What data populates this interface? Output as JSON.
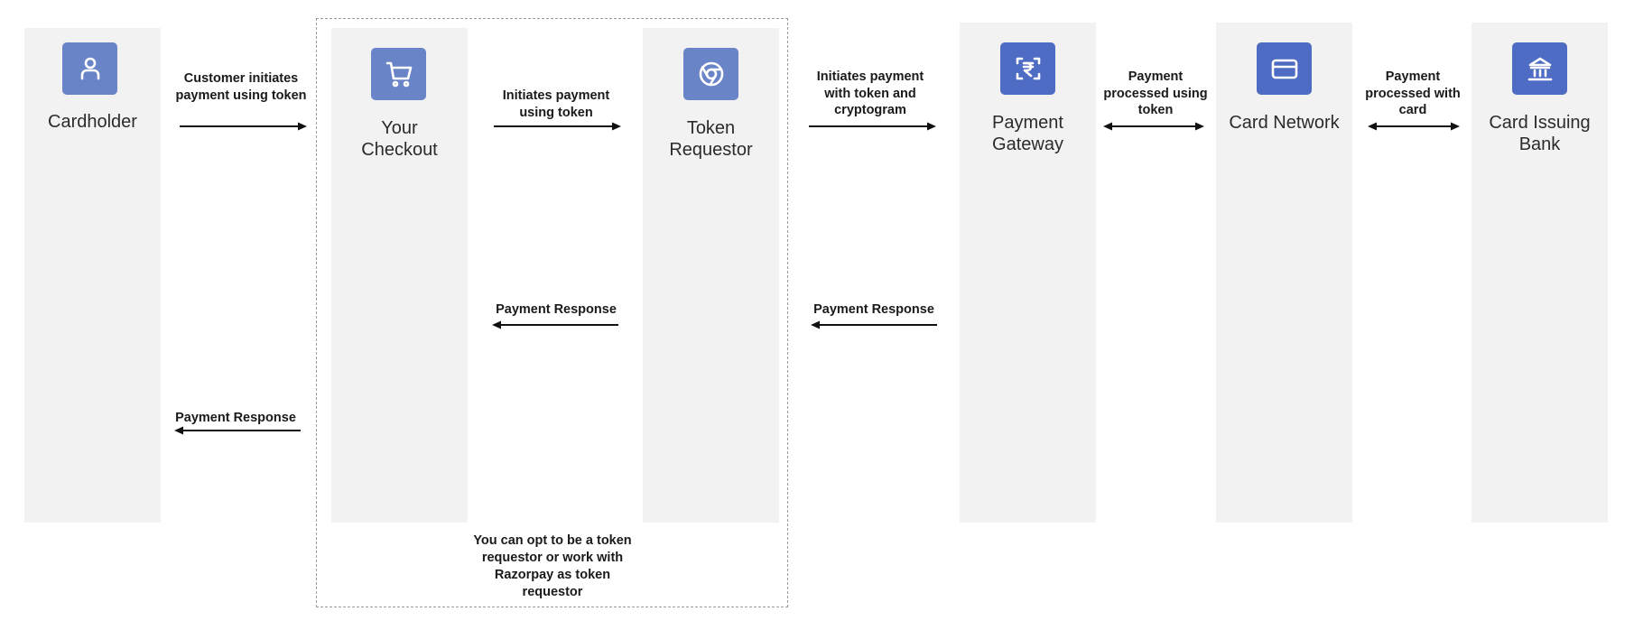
{
  "diagram": {
    "colors": {
      "column_bg": "#f2f2f2",
      "icon_bg_light": "#6a84c8",
      "icon_bg_dark": "#4e6cc4",
      "arrow": "#111111",
      "dashed_border": "#9a9a9a"
    },
    "nodes": [
      {
        "id": "cardholder",
        "title": "Cardholder",
        "icon": "user-icon"
      },
      {
        "id": "your-checkout",
        "title_line1": "Your",
        "title_line2": "Checkout",
        "icon": "shopping-cart-icon"
      },
      {
        "id": "token-requestor",
        "title_line1": "Token",
        "title_line2": "Requestor",
        "icon": "chrome-browser-icon"
      },
      {
        "id": "payment-gateway",
        "title_line1": "Payment",
        "title_line2": "Gateway",
        "icon": "rupee-scan-icon"
      },
      {
        "id": "card-network",
        "title": "Card Network",
        "icon": "credit-card-icon"
      },
      {
        "id": "card-issuing-bank",
        "title_line1": "Card Issuing",
        "title_line2": "Bank",
        "icon": "bank-icon"
      }
    ],
    "edges": [
      {
        "from": "cardholder",
        "to": "your-checkout",
        "direction": "right",
        "label_lines": [
          "Customer initiates",
          "payment using token"
        ]
      },
      {
        "from": "your-checkout",
        "to": "token-requestor",
        "direction": "right",
        "label_lines": [
          "Initiates payment",
          "using token"
        ]
      },
      {
        "from": "token-requestor",
        "to": "payment-gateway",
        "direction": "right",
        "label_lines": [
          "Initiates payment",
          "with token and",
          "cryptogram"
        ]
      },
      {
        "from": "payment-gateway",
        "to": "card-network",
        "direction": "both",
        "label_lines": [
          "Payment",
          "processed using",
          "token"
        ]
      },
      {
        "from": "card-network",
        "to": "card-issuing-bank",
        "direction": "both",
        "label_lines": [
          "Payment",
          "processed with",
          "card"
        ]
      },
      {
        "from": "token-requestor",
        "to": "your-checkout",
        "direction": "left",
        "label_lines": [
          "Payment Response"
        ]
      },
      {
        "from": "payment-gateway",
        "to": "token-requestor",
        "direction": "left",
        "label_lines": [
          "Payment Response"
        ]
      },
      {
        "from": "your-checkout",
        "to": "cardholder",
        "direction": "left",
        "label_lines": [
          "Payment Response"
        ]
      }
    ],
    "group_note_lines": [
      "You can opt to be a token",
      "requestor or work with",
      "Razorpay as token",
      "requestor"
    ]
  }
}
